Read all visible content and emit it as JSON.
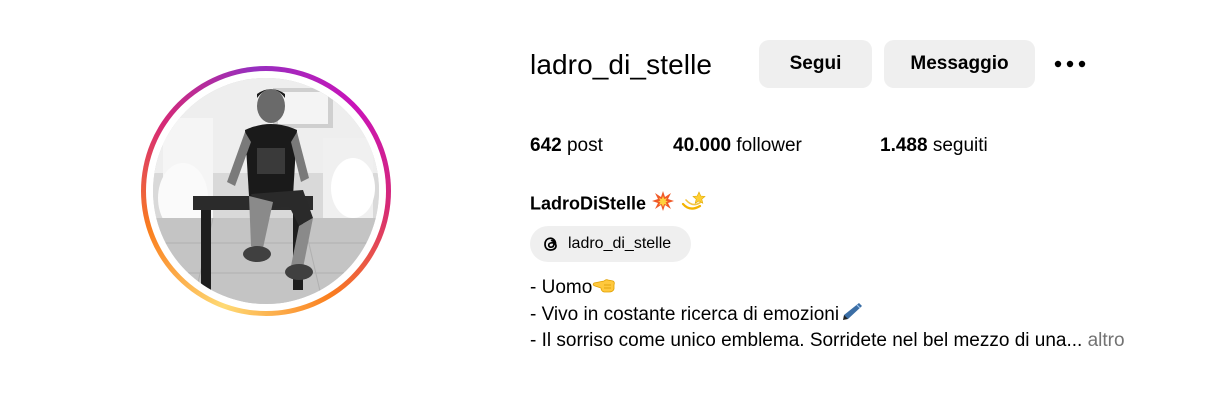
{
  "profile": {
    "username": "ladro_di_stelle",
    "display_name": "LadroDiStelle",
    "display_name_emojis": [
      "collision-emoji",
      "dizzy-emoji"
    ],
    "avatar_alt": "avatar-photo"
  },
  "actions": {
    "follow_label": "Segui",
    "message_label": "Messaggio",
    "more_icon": "more-horizontal-icon"
  },
  "stats": {
    "posts_count": "642",
    "posts_label": "post",
    "followers_count": "40.000",
    "followers_label": "follower",
    "following_count": "1.488",
    "following_label": "seguiti"
  },
  "threads": {
    "icon": "threads-icon",
    "label": "ladro_di_stelle"
  },
  "bio": {
    "line1": "- Uomo",
    "line1_emoji": "pointing-left-emoji",
    "line2": "- Vivo in costante ricerca di emozioni",
    "line2_emoji": "pen-emoji",
    "line3": "- Il sorriso come unico emblema. Sorridete nel bel mezzo di una...",
    "more_label": "altro"
  },
  "colors": {
    "button_bg": "#efefef",
    "muted_text": "#737373",
    "ring_gradient": [
      "#feda75",
      "#fa7e1e",
      "#d62976",
      "#962fbf",
      "#c913b9"
    ]
  }
}
